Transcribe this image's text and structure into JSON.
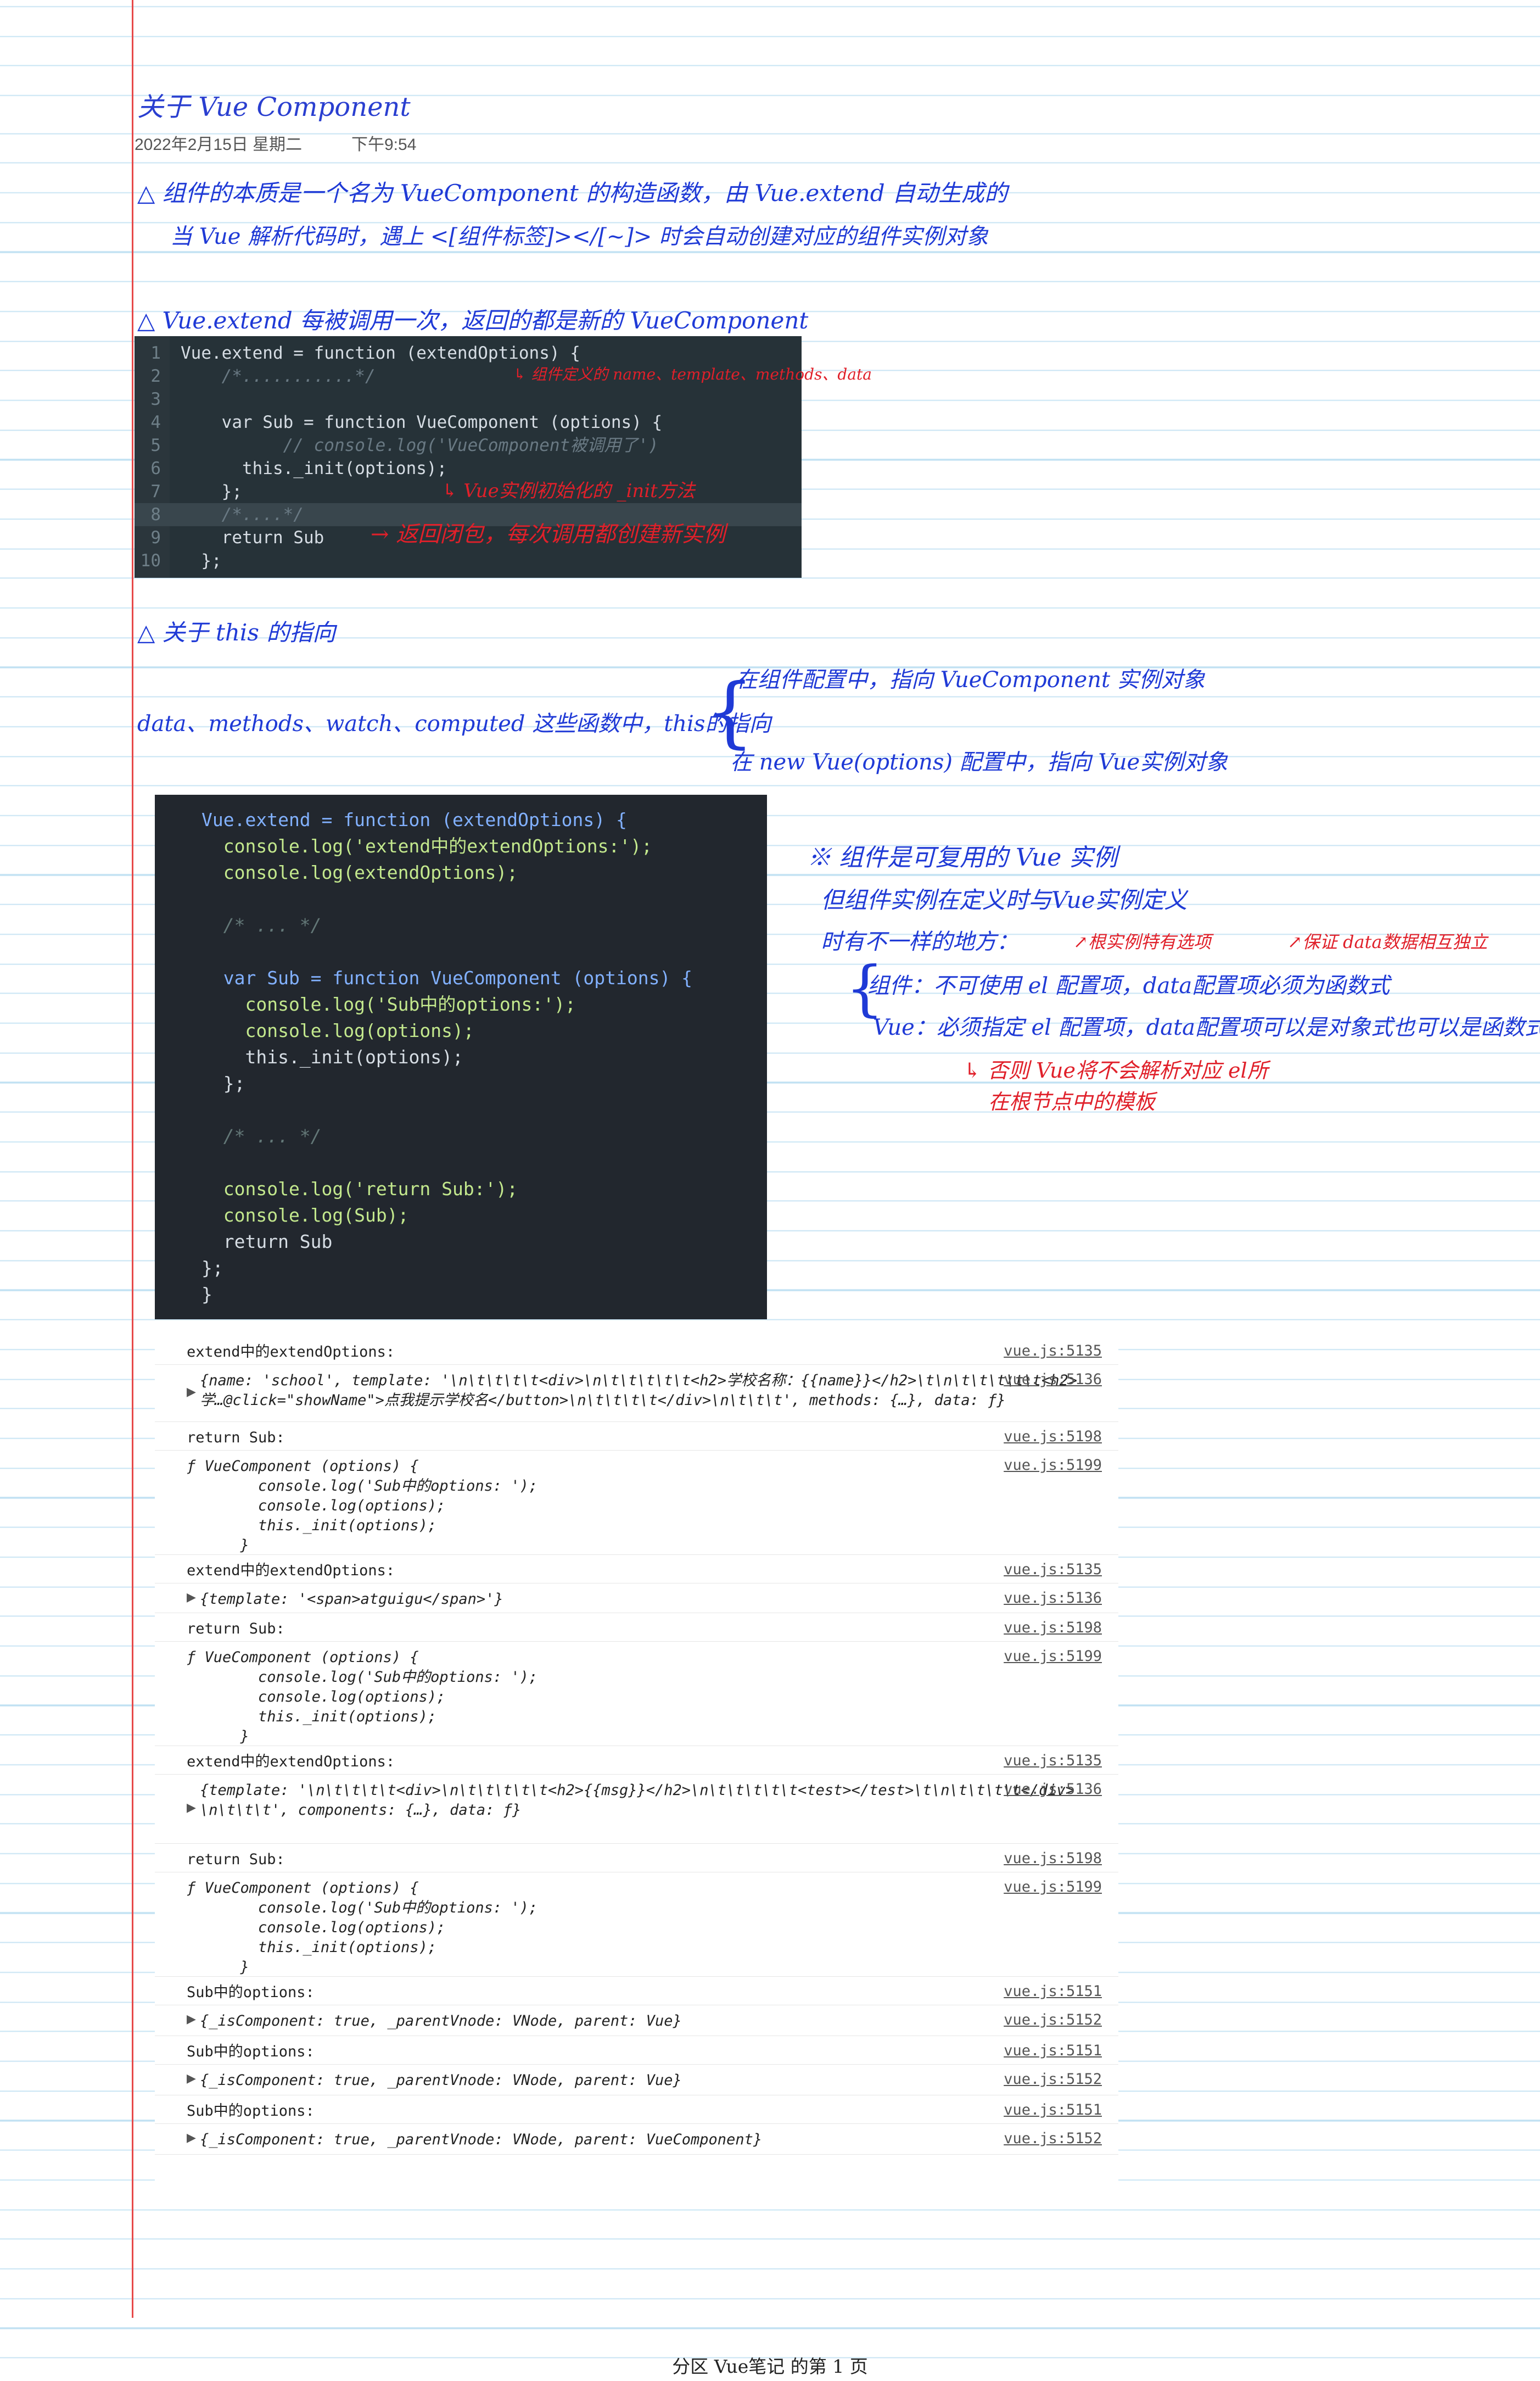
{
  "note": {
    "title": "关于 Vue Component",
    "date": "2022年2月15日 星期二",
    "time": "下午9:54",
    "footer": "分区 Vue笔记 的第 1 页"
  },
  "handwriting": {
    "line1": "△ 组件的本质是一个名为 VueComponent 的构造函数，由 Vue.extend 自动生成的",
    "line2": "当 Vue 解析代码时，遇上 <[组件标签]></[~]> 时会自动创建对应的组件实例对象",
    "line3": "△ Vue.extend 每被调用一次，返回的都是新的 VueComponent",
    "ann1": "↳ 组件定义的 name、template、methods、data",
    "ann2": "↳ Vue实例初始化的 _init方法",
    "ann3": "→ 返回闭包，每次调用都创建新实例",
    "line4": "△ 关于 this 的指向",
    "line5": "data、methods、watch、computed 这些函数中，this的指向",
    "branch1": "在组件配置中，指向 VueComponent 实例对象",
    "branch2": "在 new Vue(options) 配置中，指向 Vue实例对象",
    "r1": "※ 组件是可复用的 Vue 实例",
    "r2": "但组件实例在定义时与Vue实例定义",
    "r3": "时有不一样的地方：",
    "r4a": "↗根实例特有选项",
    "r4b": "↗保证 data数据相互独立",
    "r5": "组件：不可使用 el 配置项，data配置项必须为函数式",
    "r6": "Vue：必须指定 el 配置项，data配置项可以是对象式也可以是函数式",
    "r7": "↳ 否则 Vue将不会解析对应 el所",
    "r8": "在根节点中的模板"
  },
  "code1": [
    {
      "n": "1",
      "t": "Vue.extend = function (extendOptions) {"
    },
    {
      "n": "2",
      "t": "    /*...........*/"
    },
    {
      "n": "3",
      "t": ""
    },
    {
      "n": "4",
      "t": "    var Sub = function VueComponent (options) {"
    },
    {
      "n": "5",
      "t": "          // console.log('VueComponent被调用了')"
    },
    {
      "n": "6",
      "t": "      this._init(options);"
    },
    {
      "n": "7",
      "t": "    };"
    },
    {
      "n": "8",
      "t": "    /*....*/"
    },
    {
      "n": "9",
      "t": "    return Sub"
    },
    {
      "n": "10",
      "t": "  };"
    }
  ],
  "code2": [
    "Vue.extend = function (extendOptions) {",
    "  console.log('extend中的extendOptions:');",
    "  console.log(extendOptions);",
    "",
    "  /* ... */",
    "",
    "  var Sub = function VueComponent (options) {",
    "    console.log('Sub中的options:');",
    "    console.log(options);",
    "    this._init(options);",
    "  };",
    "",
    "  /* ... */",
    "",
    "  console.log('return Sub:');",
    "  console.log(Sub);",
    "  return Sub",
    "};",
    "}"
  ],
  "console": [
    {
      "msg": "extend中的extendOptions:",
      "src": "vue.js:5135",
      "h": 52
    },
    {
      "msg": "{name: 'school', template: '\\n\\t\\t\\t\\t<div>\\n\\t\\t\\t\\t\\t<h2>学校名称：{{name}}</h2>\\t\\n\\t\\t\\t\\t\\t<h2>\n学…@click=\"showName\">点我提示学校名</button>\\n\\t\\t\\t\\t</div>\\n\\t\\t\\t', methods: {…}, data: ƒ}",
      "src": "vue.js:5136",
      "h": 104,
      "tri": true
    },
    {
      "msg": "return Sub:",
      "src": "vue.js:5198",
      "h": 52
    },
    {
      "msg": "ƒ VueComponent (options) {\n        console.log('Sub中的options: ');\n        console.log(options);\n        this._init(options);\n      }",
      "src": "vue.js:5199",
      "h": 190
    },
    {
      "msg": "extend中的extendOptions:",
      "src": "vue.js:5135",
      "h": 52
    },
    {
      "msg": "{template: '<span>atguigu</span>'}",
      "src": "vue.js:5136",
      "h": 54,
      "tri": true
    },
    {
      "msg": "return Sub:",
      "src": "vue.js:5198",
      "h": 52
    },
    {
      "msg": "ƒ VueComponent (options) {\n        console.log('Sub中的options: ');\n        console.log(options);\n        this._init(options);\n      }",
      "src": "vue.js:5199",
      "h": 190
    },
    {
      "msg": "extend中的extendOptions:",
      "src": "vue.js:5135",
      "h": 52
    },
    {
      "msg": "{template: '\\n\\t\\t\\t\\t<div>\\n\\t\\t\\t\\t\\t<h2>{{msg}}</h2>\\n\\t\\t\\t\\t\\t<test></test>\\t\\n\\t\\t\\t\\t</div>\n\\n\\t\\t\\t', components: {…}, data: ƒ}",
      "src": "vue.js:5136",
      "h": 126,
      "tri": true
    },
    {
      "msg": "return Sub:",
      "src": "vue.js:5198",
      "h": 52
    },
    {
      "msg": "ƒ VueComponent (options) {\n        console.log('Sub中的options: ');\n        console.log(options);\n        this._init(options);\n      }",
      "src": "vue.js:5199",
      "h": 190
    },
    {
      "msg": "Sub中的options:",
      "src": "vue.js:5151",
      "h": 52
    },
    {
      "msg": "{_isComponent: true, _parentVnode: VNode, parent: Vue}",
      "src": "vue.js:5152",
      "h": 56,
      "tri": true
    },
    {
      "msg": "Sub中的options:",
      "src": "vue.js:5151",
      "h": 52
    },
    {
      "msg": "{_isComponent: true, _parentVnode: VNode, parent: Vue}",
      "src": "vue.js:5152",
      "h": 56,
      "tri": true
    },
    {
      "msg": "Sub中的options:",
      "src": "vue.js:5151",
      "h": 52
    },
    {
      "msg": "{_isComponent: true, _parentVnode: VNode, parent: VueComponent}",
      "src": "vue.js:5152",
      "h": 56,
      "tri": true
    }
  ]
}
